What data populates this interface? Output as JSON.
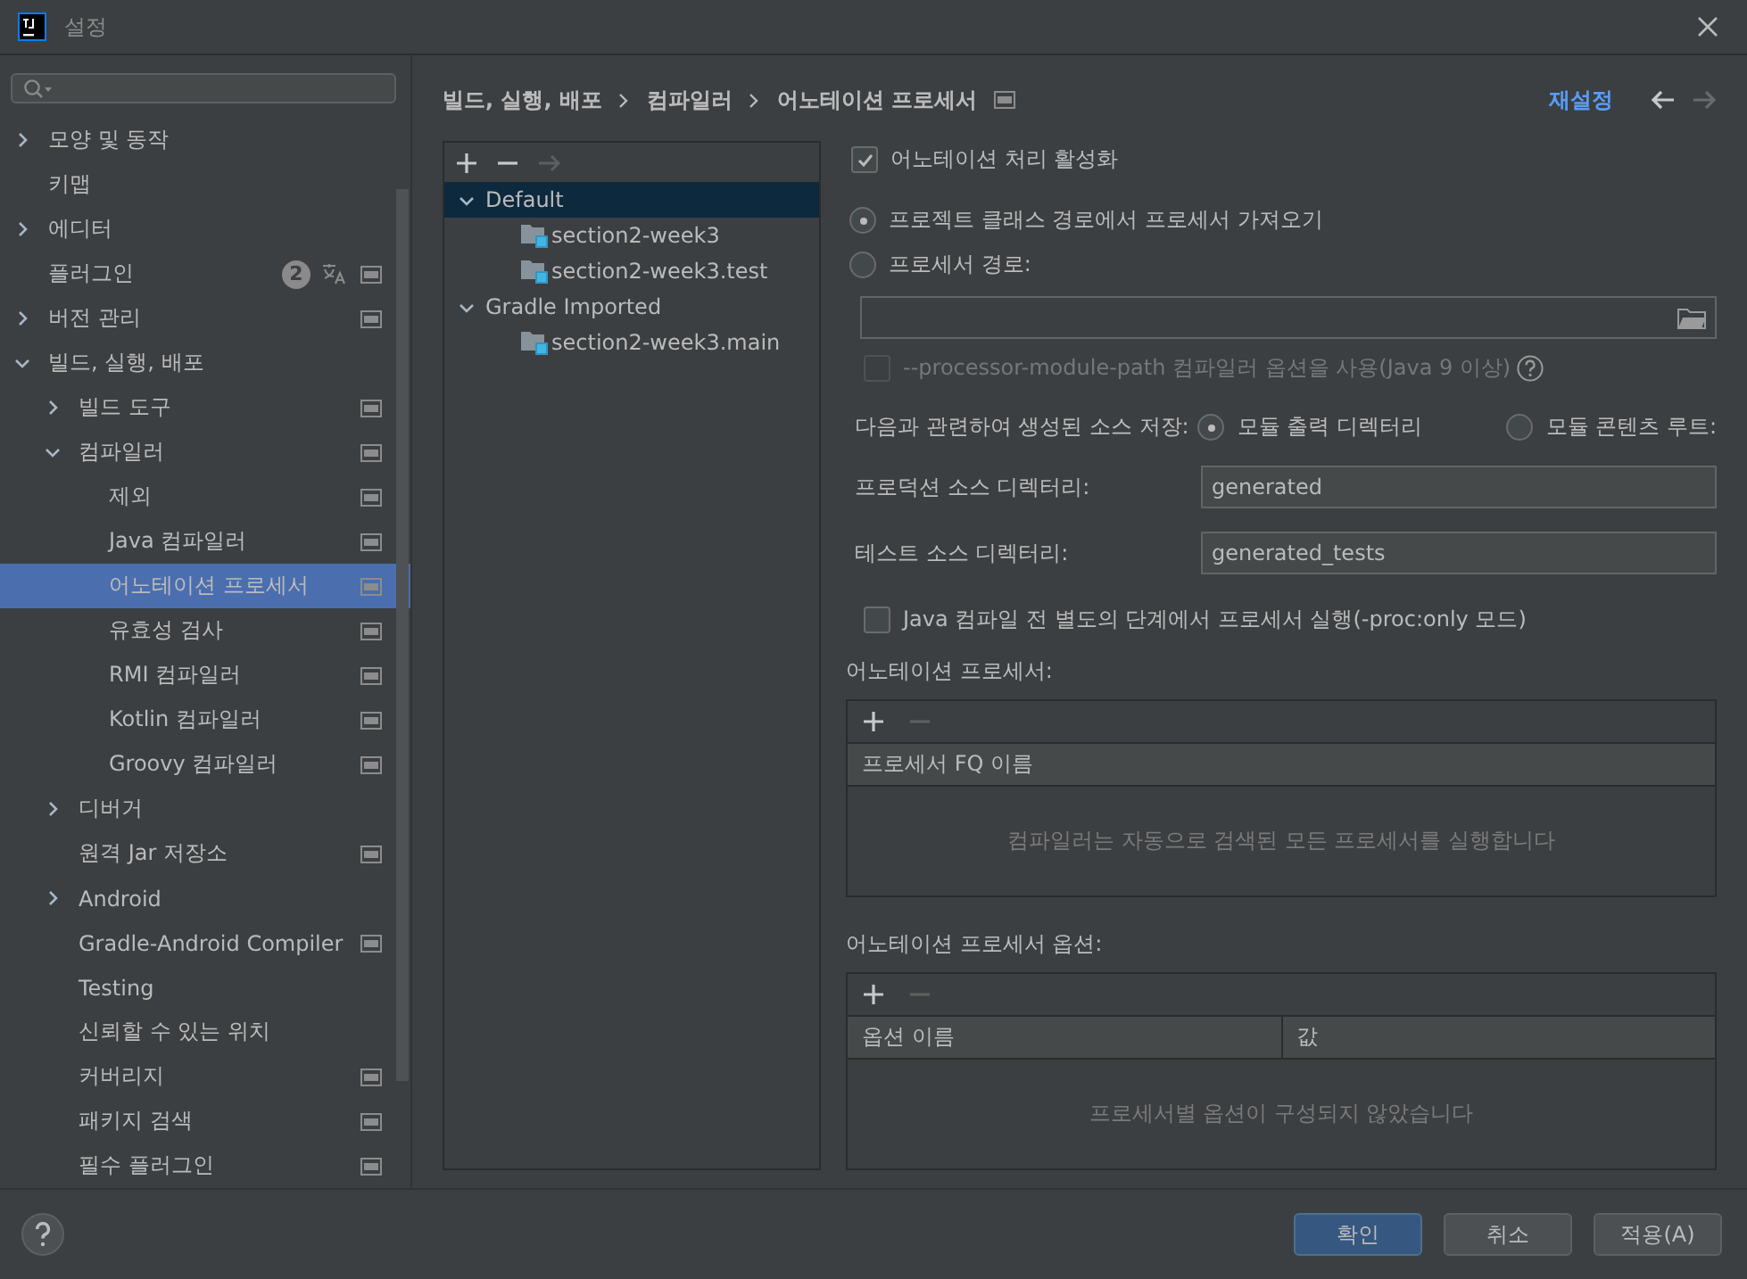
{
  "window": {
    "title": "설정"
  },
  "sidebar": {
    "items": [
      {
        "label": "모양 및 동작",
        "expanded": false,
        "selected": false,
        "project": false
      },
      {
        "label": "키맵",
        "selected": false,
        "project": false
      },
      {
        "label": "에디터",
        "expanded": false,
        "selected": false,
        "project": false
      },
      {
        "label": "플러그인",
        "selected": false,
        "project": true,
        "badge": "2",
        "translate": true
      },
      {
        "label": "버전 관리",
        "expanded": false,
        "selected": false,
        "project": true
      },
      {
        "label": "빌드, 실행, 배포",
        "expanded": true,
        "selected": false,
        "project": false,
        "children": [
          {
            "label": "빌드 도구",
            "expanded": false,
            "selected": false,
            "project": true
          },
          {
            "label": "컴파일러",
            "expanded": true,
            "selected": false,
            "project": true,
            "children": [
              {
                "label": "제외",
                "selected": false,
                "project": true
              },
              {
                "label": "Java 컴파일러",
                "selected": false,
                "project": true
              },
              {
                "label": "어노테이션 프로세서",
                "selected": true,
                "project": true
              },
              {
                "label": "유효성 검사",
                "selected": false,
                "project": true
              },
              {
                "label": "RMI 컴파일러",
                "selected": false,
                "project": true
              },
              {
                "label": "Kotlin 컴파일러",
                "selected": false,
                "project": true
              },
              {
                "label": "Groovy 컴파일러",
                "selected": false,
                "project": true
              }
            ]
          },
          {
            "label": "디버거",
            "expanded": false,
            "selected": false,
            "project": false
          },
          {
            "label": "원격 Jar 저장소",
            "selected": false,
            "project": true
          },
          {
            "label": "Android",
            "expanded": false,
            "selected": false,
            "project": false
          },
          {
            "label": "Gradle-Android Compiler",
            "selected": false,
            "project": true
          },
          {
            "label": "Testing",
            "selected": false,
            "project": false
          },
          {
            "label": "신뢰할 수 있는 위치",
            "selected": false,
            "project": false
          },
          {
            "label": "커버리지",
            "selected": false,
            "project": true
          },
          {
            "label": "패키지 검색",
            "selected": false,
            "project": true
          },
          {
            "label": "필수 플러그인",
            "selected": false,
            "project": true
          }
        ]
      }
    ]
  },
  "breadcrumb": [
    "빌드, 실행, 배포",
    "컴파일러",
    "어노테이션 프로세서"
  ],
  "reset_link": "재설정",
  "profiles": [
    {
      "label": "Default",
      "selected": true,
      "expanded": true,
      "children": [
        {
          "label": "section2-week3",
          "selected": false
        },
        {
          "label": "section2-week3.test",
          "selected": false
        }
      ]
    },
    {
      "label": "Gradle Imported",
      "selected": false,
      "expanded": true,
      "children": [
        {
          "label": "section2-week3.main",
          "selected": false
        }
      ]
    }
  ],
  "enable_processing": {
    "label": "어노테이션 처리 활성화",
    "checked": true
  },
  "source": [
    {
      "label": "프로젝트 클래스 경로에서 프로세서 가져오기",
      "selected": true
    },
    {
      "label": "프로세서 경로:",
      "selected": false
    }
  ],
  "module_path": {
    "label": "--processor-module-path 컴파일러 옵션을 사용(Java 9 이상)",
    "checked": false,
    "disabled": true
  },
  "store": {
    "label": "다음과 관련하여 생성된 소스 저장:",
    "options": [
      {
        "label": "모듈 출력 디렉터리",
        "selected": true
      },
      {
        "label": "모듈 콘텐츠 루트:",
        "selected": false
      }
    ]
  },
  "fields": [
    {
      "label": "프로덕션 소스 디렉터리:",
      "value": "generated"
    },
    {
      "label": "테스트 소스 디렉터리:",
      "value": "generated_tests"
    }
  ],
  "proc_only": {
    "label": "Java 컴파일 전 별도의 단계에서 프로세서 실행(-proc:only 모드)",
    "checked": false
  },
  "processors": {
    "title": "어노테이션 프로세서:",
    "columns": [
      "프로세서 FQ 이름"
    ],
    "empty_text": "컴파일러는 자동으로 검색된 모든 프로세서를 실행합니다"
  },
  "options": {
    "title": "어노테이션 프로세서 옵션:",
    "columns": [
      "옵션 이름",
      "값"
    ],
    "empty_text": "프로세서별 옵션이 구성되지 않았습니다"
  },
  "buttons": [
    {
      "label": "확인",
      "kind": "primary"
    },
    {
      "label": "취소",
      "kind": "normal"
    },
    {
      "label": "적용(A)",
      "kind": "normal"
    }
  ]
}
